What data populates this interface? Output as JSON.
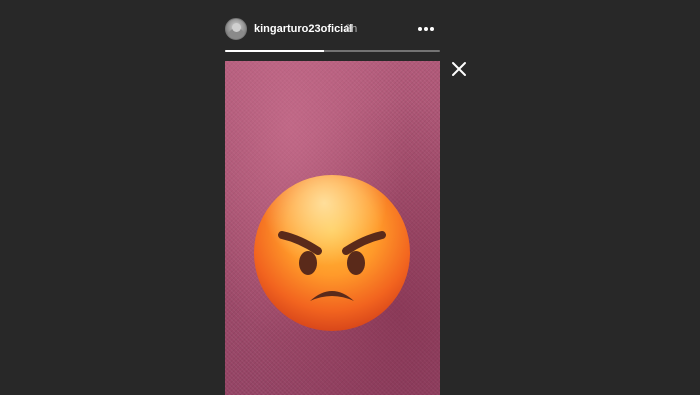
{
  "story": {
    "username": "kingarturo23oficial",
    "timestamp": "3h",
    "progress_fraction": 0.46,
    "sticker": "angry-face-emoji"
  },
  "icons": {
    "avatar": "avatar",
    "more": "more-horizontal-icon",
    "close": "close-icon"
  },
  "colors": {
    "background": "#282828",
    "text_primary": "#ffffff",
    "text_secondary": "#b5b5b5",
    "media_tint": "#a8506e"
  }
}
